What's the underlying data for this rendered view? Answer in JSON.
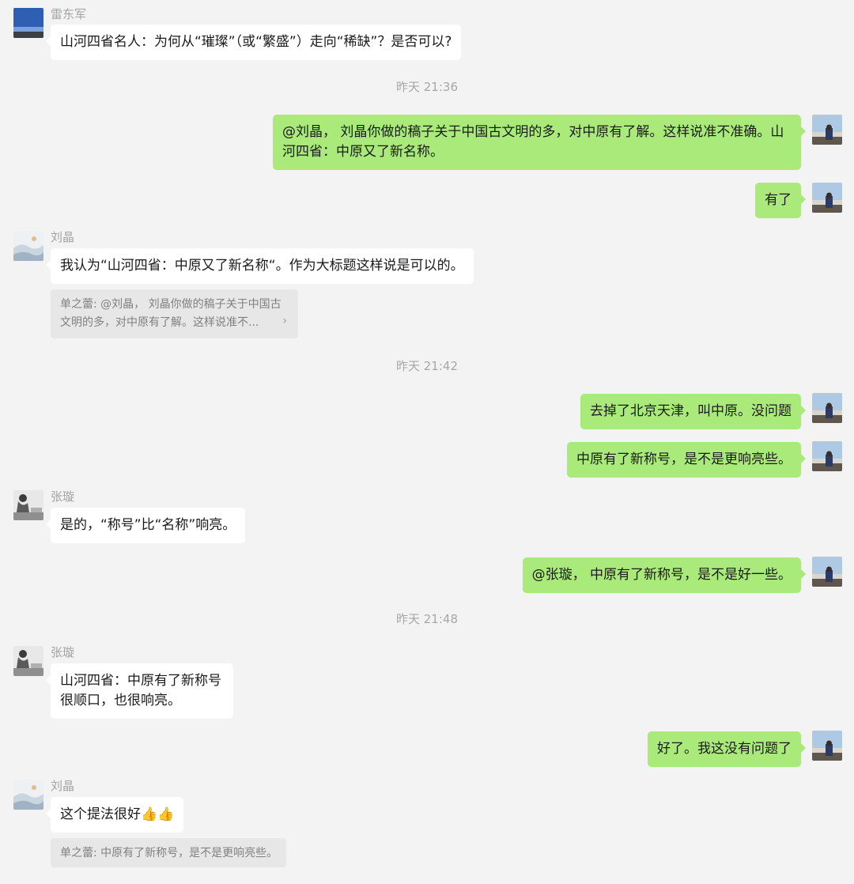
{
  "senders": {
    "leidongjun": "雷东军",
    "liujing": "刘晶",
    "zhangxuan": "张璇"
  },
  "messages": {
    "m1": "山河四省名人：为何从“璀璨”（或“繁盛”）走向“稀缺”？是否可以?",
    "m2": "@刘晶， 刘晶你做的稿子关于中国古文明的多，对中原有了解。这样说准不准确。山河四省：中原又了新名称。",
    "m3": "有了",
    "m4": "我认为“山河四省：中原又了新名称“。作为大标题这样说是可以的。",
    "m5": "去掉了北京天津，叫中原。没问题",
    "m6": "中原有了新称号，是不是更响亮些。",
    "m7": "是的，“称号”比“名称”响亮。",
    "m8": "@张璇， 中原有了新称号，是不是好一些。",
    "m9": "山河四省：中原有了新称号\n很顺口，也很响亮。",
    "m10": "好了。我这没有问题了",
    "m11": "这个提法很好👍👍"
  },
  "quotes": {
    "q1": "单之蕾: @刘晶， 刘晶你做的稿子关于中国古文明的多，对中原有了解。这样说准不...",
    "q2": "单之蕾: 中原有了新称号，是不是更响亮些。"
  },
  "timestamps": {
    "t1": "昨天 21:36",
    "t2": "昨天 21:42",
    "t3": "昨天 21:48"
  },
  "icons": {
    "chevron": "chevron-right-icon"
  }
}
